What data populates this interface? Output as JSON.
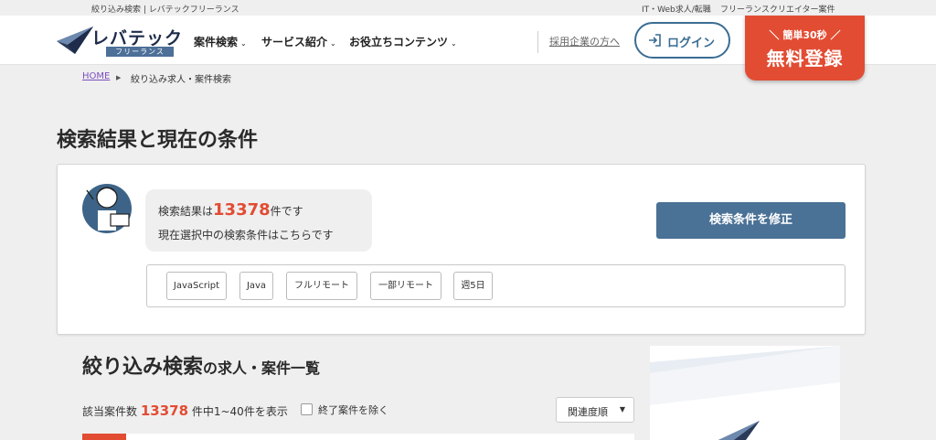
{
  "topbar": {
    "left_text": "絞り込み検索 | レバテックフリーランス",
    "right_links": [
      "IT・Web求人/転職",
      "フリーランスクリエイター案件"
    ]
  },
  "header": {
    "logo_text": "レバテック",
    "logo_sub": "フリーランス",
    "nav": [
      "案件検索",
      "サービス紹介",
      "お役立ちコンテンツ"
    ],
    "recruit_link": "採用企業の方へ",
    "login_label": "ログイン",
    "register_small": "＼ 簡単30秒 ／",
    "register_big": "無料登録",
    "accent_color": "#e24c33",
    "brand_color": "#3a6d93"
  },
  "breadcrumb": {
    "home": "HOME",
    "current": "絞り込み求人・案件検索"
  },
  "page_title": "検索結果と現在の条件",
  "result": {
    "prefix": "検索結果は",
    "count": "13378",
    "suffix": "件です",
    "line2": "現在選択中の検索条件はこちらです",
    "modify_button": "検索条件を修正"
  },
  "tags": [
    "JavaScript",
    "Java",
    "フルリモート",
    "一部リモート",
    "週5日"
  ],
  "listing": {
    "title_big": "絞り込み検索",
    "title_small": "の求人・案件一覧",
    "count_prefix": "該当案件数",
    "count": "13378",
    "count_suffix": "件中1~40件を表示",
    "exclude_label": "終了案件を除く",
    "sort_label": "関連度順"
  }
}
